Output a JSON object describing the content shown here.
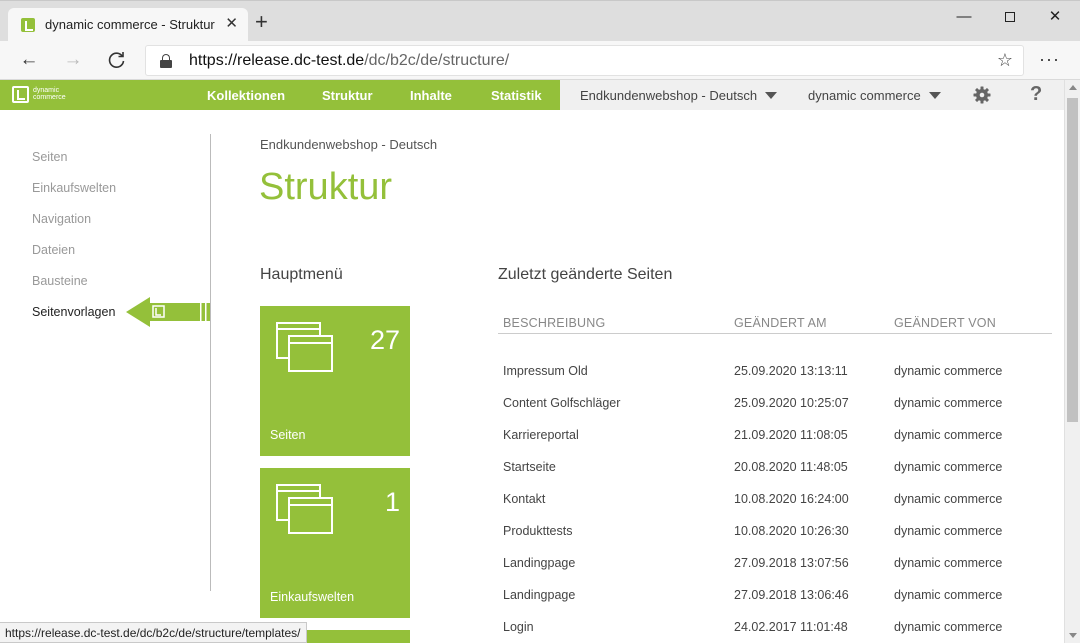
{
  "browser": {
    "tab_title": "dynamic commerce - Struktur",
    "url_host": "https://release.dc-test.de",
    "url_path": "/dc/b2c/de/structure/",
    "status_url": "https://release.dc-test.de/dc/b2c/de/structure/templates/"
  },
  "app": {
    "logo_line1": "dynamic",
    "logo_line2": "commerce",
    "brand_color": "#94c03a",
    "nav": [
      {
        "label": "Kollektionen"
      },
      {
        "label": "Struktur"
      },
      {
        "label": "Inhalte"
      },
      {
        "label": "Statistik"
      }
    ],
    "shop_select": "Endkundenwebshop - Deutsch",
    "user_select": "dynamic commerce",
    "help_label": "?"
  },
  "sidebar": {
    "items": [
      {
        "label": "Seiten"
      },
      {
        "label": "Einkaufswelten"
      },
      {
        "label": "Navigation"
      },
      {
        "label": "Dateien"
      },
      {
        "label": "Bausteine"
      },
      {
        "label": "Seitenvorlagen"
      }
    ]
  },
  "main": {
    "breadcrumb": "Endkundenwebshop - Deutsch",
    "title": "Struktur",
    "hauptmenu_title": "Hauptmenü",
    "tiles": [
      {
        "count": "27",
        "label": "Seiten"
      },
      {
        "count": "1",
        "label": "Einkaufswelten"
      }
    ],
    "recent_title": "Zuletzt geänderte Seiten",
    "table": {
      "headers": [
        "Beschreibung",
        "Geändert am",
        "Geändert von"
      ],
      "rows": [
        [
          "Impressum Old",
          "25.09.2020 13:13:11",
          "dynamic commerce"
        ],
        [
          "Content Golfschläger",
          "25.09.2020 10:25:07",
          "dynamic commerce"
        ],
        [
          "Karriereportal",
          "21.09.2020 11:08:05",
          "dynamic commerce"
        ],
        [
          "Startseite",
          "20.08.2020 11:48:05",
          "dynamic commerce"
        ],
        [
          "Kontakt",
          "10.08.2020 16:24:00",
          "dynamic commerce"
        ],
        [
          "Produkttests",
          "10.08.2020 10:26:30",
          "dynamic commerce"
        ],
        [
          "Landingpage",
          "27.09.2018 13:07:56",
          "dynamic commerce"
        ],
        [
          "Landingpage",
          "27.09.2018 13:06:46",
          "dynamic commerce"
        ],
        [
          "Login",
          "24.02.2017 11:01:48",
          "dynamic commerce"
        ]
      ]
    }
  }
}
